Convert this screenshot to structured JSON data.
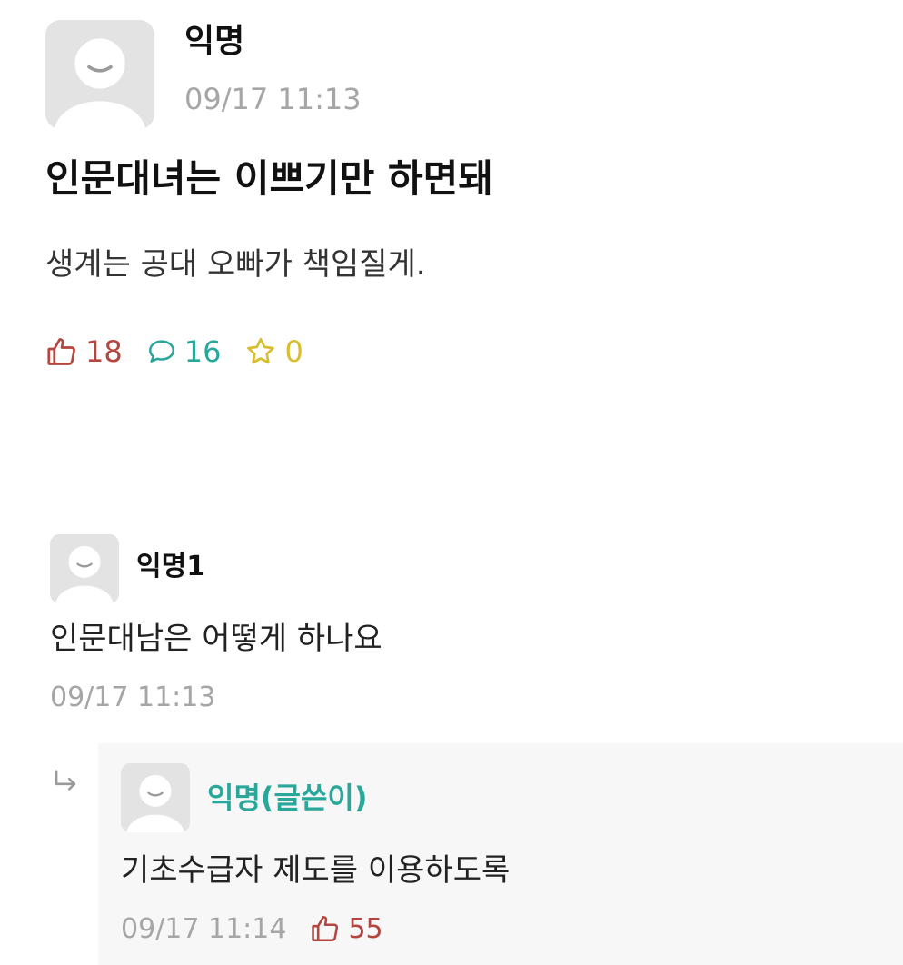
{
  "post": {
    "author": "익명",
    "time": "09/17 11:13",
    "title": "인문대녀는 이쁘기만 하면돼",
    "body": "생계는 공대 오빠가 책임질게.",
    "likes": "18",
    "comments": "16",
    "scraps": "0"
  },
  "comment": {
    "author": "익명1",
    "text": "인문대남은 어떻게 하나요",
    "time": "09/17 11:13"
  },
  "reply": {
    "author": "익명(글쓴이)",
    "text": "기초수급자 제도를 이용하도록",
    "time": "09/17 11:14",
    "likes": "55"
  },
  "colors": {
    "like": "#b5453f",
    "comment": "#2aa79b",
    "scrap": "#d9bd2e",
    "author_highlight": "#2aa79b",
    "timestamp": "#a6a6a6"
  },
  "icons": {
    "avatar": "default-profile-icon",
    "like": "thumbs-up-icon",
    "comment": "speech-bubble-icon",
    "scrap": "star-icon",
    "reply": "reply-arrow-icon"
  }
}
